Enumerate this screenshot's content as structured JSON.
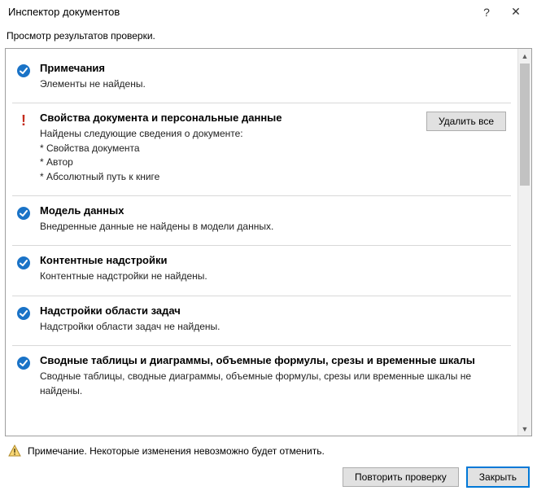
{
  "window": {
    "title": "Инспектор документов",
    "help": "?",
    "close": "✕"
  },
  "subheader": "Просмотр результатов проверки.",
  "sections": [
    {
      "status": "ok",
      "heading": "Примечания",
      "desc": "Элементы не найдены."
    },
    {
      "status": "warn",
      "heading": "Свойства документа и персональные данные",
      "desc": "Найдены следующие сведения о документе:\n* Свойства документа\n* Автор\n* Абсолютный путь к книге",
      "action": "Удалить все"
    },
    {
      "status": "ok",
      "heading": "Модель данных",
      "desc": "Внедренные данные не найдены в модели данных."
    },
    {
      "status": "ok",
      "heading": "Контентные надстройки",
      "desc": "Контентные надстройки не найдены."
    },
    {
      "status": "ok",
      "heading": "Надстройки области задач",
      "desc": "Надстройки области задач не найдены."
    },
    {
      "status": "ok",
      "heading": "Сводные таблицы и диаграммы, объемные формулы, срезы и временные шкалы",
      "desc": "Сводные таблицы, сводные диаграммы, объемные формулы, срезы или временные шкалы не найдены."
    }
  ],
  "footer": {
    "note": "Примечание. Некоторые изменения невозможно будет отменить.",
    "reinspect": "Повторить проверку",
    "close": "Закрыть"
  }
}
